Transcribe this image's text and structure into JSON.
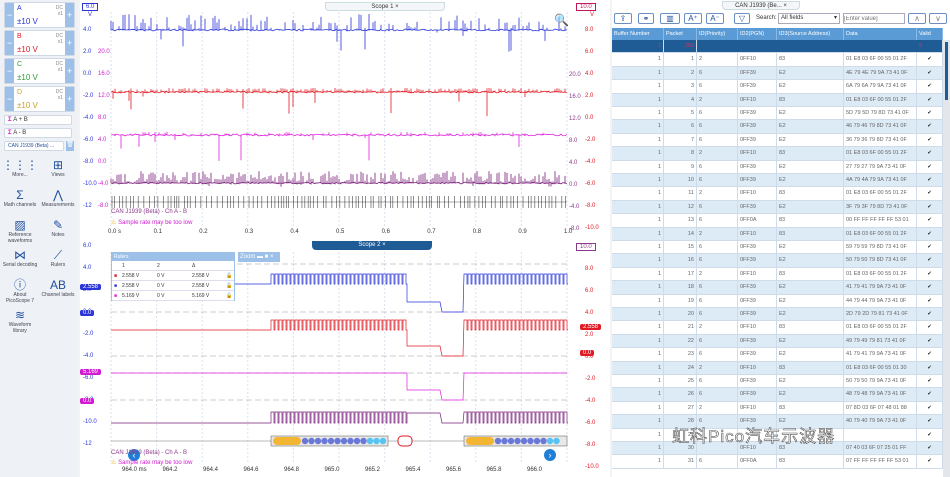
{
  "sidebar": {
    "channels": [
      {
        "name": "A",
        "range": "±10 V",
        "coupling": "DC",
        "probe": "x1",
        "color": "#2b35d8"
      },
      {
        "name": "B",
        "range": "±10 V",
        "coupling": "DC",
        "probe": "x1",
        "color": "#e01b24"
      },
      {
        "name": "C",
        "range": "±10 V",
        "coupling": "DC",
        "probe": "x1",
        "color": "#2e9e3a"
      },
      {
        "name": "D",
        "range": "±10 V",
        "coupling": "DC",
        "probe": "x1",
        "color": "#c9a227"
      }
    ],
    "math": [
      {
        "label": "A + B"
      },
      {
        "label": "A - B"
      }
    ],
    "decoder": "CAN J1939 (Beta) ...",
    "tools": [
      {
        "label": "More...",
        "icon": "⋮⋮⋮"
      },
      {
        "label": "Views",
        "icon": "⊞"
      },
      {
        "label": "Math channels",
        "icon": "Σ"
      },
      {
        "label": "Measurements",
        "icon": "⋀"
      },
      {
        "label": "Reference waveforms",
        "icon": "▨"
      },
      {
        "label": "Notes",
        "icon": "✎"
      },
      {
        "label": "Serial decoding",
        "icon": "⋈"
      },
      {
        "label": "Rulers",
        "icon": "⟋"
      },
      {
        "label": "About PicoScope 7",
        "icon": "ⓘ"
      },
      {
        "label": "Channel labels",
        "icon": "AB"
      },
      {
        "label": "Waveform library",
        "icon": "≋"
      }
    ]
  },
  "scope1": {
    "tab": "Scope 1",
    "left_top": "6.0",
    "right_top": "10.0",
    "unit": "V",
    "axis_a": [
      "4.0",
      "2.0",
      "0.0",
      "-2.0",
      "-4.0",
      "-6.0",
      "-8.0",
      "-10.0",
      "-12"
    ],
    "axis_b": [
      "20.0",
      "16.0",
      "12.0",
      "8.0",
      "4.0",
      "0.0",
      "-4.0",
      "-8.0"
    ],
    "axis_r1": [
      "20.0",
      "16.0",
      "12.0",
      "8.0",
      "4.0",
      "0.0",
      "-4.0",
      "-8.0"
    ],
    "axis_r2": [
      "8.0",
      "6.0",
      "4.0",
      "2.0",
      "0.0",
      "-2.0",
      "-4.0",
      "-6.0",
      "-8.0",
      "-10.0"
    ],
    "time": [
      "0.0 s",
      "0.1",
      "0.2",
      "0.3",
      "0.4",
      "0.5",
      "0.6",
      "0.7",
      "0.8",
      "0.9",
      "1.0"
    ],
    "decoder_label": "CAN J1939 (Beta) - Ch A - B",
    "warning": "Sample rate may be too low"
  },
  "scope2": {
    "tab": "Scope 2",
    "right_top": "10.0",
    "axis_a": [
      "6.0",
      "4.0",
      "2.0",
      "0.0",
      "-2.0",
      "-4.0",
      "-6.0",
      "-8.0",
      "-10.0",
      "-12"
    ],
    "axis_r2": [
      "8.0",
      "6.0",
      "4.0",
      "2.0",
      "0.0",
      "-2.0",
      "-4.0",
      "-6.0",
      "-8.0",
      "-10.0"
    ],
    "markers": {
      "a_ruler": "2.558",
      "a_zero": "0.0",
      "b_ruler": "2.558",
      "b_zero": "0.0",
      "c_ruler": "5.169",
      "c_zero": "0.0"
    },
    "time": [
      "964.0 ms",
      "964.2",
      "964.4",
      "964.6",
      "964.8",
      "965.0",
      "965.2",
      "965.4",
      "965.6",
      "965.8",
      "966.0"
    ],
    "decoder_label": "CAN J1939 (Beta) - Ch A - B",
    "warning": "Sample rate may be too low",
    "rulers": {
      "title": "Rulers",
      "cols": [
        "1",
        "2",
        "Δ"
      ],
      "rows": [
        {
          "color": "#e01b24",
          "v1": "2.558 V",
          "v2": "0 V",
          "d": "2.558 V"
        },
        {
          "color": "#2b35d8",
          "v1": "2.558 V",
          "v2": "0 V",
          "d": "2.558 V"
        },
        {
          "color": "#e020e0",
          "v1": "5.169 V",
          "v2": "0 V",
          "d": "5.169 V"
        }
      ]
    },
    "zoom_title": "Zoom"
  },
  "table": {
    "tab": "CAN J1939 (Be... ×",
    "search_label": "Search:",
    "search_field": "All fields",
    "search_placeholder": "[Enter value]",
    "columns": [
      "Buffer Number",
      "Packet",
      "ID(Priority)",
      "ID2(PGN)",
      "ID3(Source Address)",
      "Data",
      "Valid"
    ],
    "summary": {
      "buffer": "1",
      "packet": "250",
      "valid": "8"
    },
    "rows": [
      [
        "1",
        "1",
        "2",
        "0FF10",
        "83",
        "01 E8 03 6F 00 55 01 2F"
      ],
      [
        "1",
        "2",
        "6",
        "0FF39",
        "E2",
        "4E 79 4E 79 9A 73 41 0F"
      ],
      [
        "1",
        "3",
        "6",
        "0FF39",
        "E2",
        "6A 79 6A 79 9A 73 41 0F"
      ],
      [
        "1",
        "4",
        "2",
        "0FF10",
        "83",
        "01 E8 03 6F 00 55 01 2F"
      ],
      [
        "1",
        "5",
        "6",
        "0FF39",
        "E2",
        "5D 79 5D 79 8D 73 41 0F"
      ],
      [
        "1",
        "6",
        "6",
        "0FF39",
        "E2",
        "46 79 46 79 8D 73 41 0F"
      ],
      [
        "1",
        "7",
        "6",
        "0FF39",
        "E2",
        "36 79 36 79 8D 73 41 0F"
      ],
      [
        "1",
        "8",
        "2",
        "0FF10",
        "83",
        "01 E8 03 6F 00 55 01 2F"
      ],
      [
        "1",
        "9",
        "6",
        "0FF39",
        "E2",
        "27 79 27 79 9A 73 41 0F"
      ],
      [
        "1",
        "10",
        "6",
        "0FF39",
        "E2",
        "4A 79 4A 79 9A 73 41 0F"
      ],
      [
        "1",
        "11",
        "2",
        "0FF10",
        "83",
        "01 E8 03 6F 00 55 01 2F"
      ],
      [
        "1",
        "12",
        "6",
        "0FF39",
        "E2",
        "3F 79 3F 79 8D 73 41 0F"
      ],
      [
        "1",
        "13",
        "6",
        "0FF0A",
        "83",
        "00 FF FF FF FF FF 53 01"
      ],
      [
        "1",
        "14",
        "2",
        "0FF10",
        "83",
        "01 E8 03 6F 00 55 01 2F"
      ],
      [
        "1",
        "15",
        "6",
        "0FF39",
        "E2",
        "59 79 59 79 8D 73 41 0F"
      ],
      [
        "1",
        "16",
        "6",
        "0FF39",
        "E2",
        "50 79 50 79 8D 73 41 0F"
      ],
      [
        "1",
        "17",
        "2",
        "0FF10",
        "83",
        "01 E8 03 6F 00 55 01 2F"
      ],
      [
        "1",
        "18",
        "6",
        "0FF39",
        "E2",
        "41 79 41 79 9A 73 41 0F"
      ],
      [
        "1",
        "19",
        "6",
        "0FF39",
        "E2",
        "44 79 44 79 9A 73 41 0F"
      ],
      [
        "1",
        "20",
        "6",
        "0FF39",
        "E2",
        "2D 79 2D 79 81 73 41 0F"
      ],
      [
        "1",
        "21",
        "2",
        "0FF10",
        "83",
        "01 E8 03 6F 00 55 01 2F"
      ],
      [
        "1",
        "22",
        "6",
        "0FF39",
        "E2",
        "49 79 49 79 81 73 41 0F"
      ],
      [
        "1",
        "23",
        "6",
        "0FF39",
        "E2",
        "41 79 41 79 9A 73 41 0F"
      ],
      [
        "1",
        "24",
        "2",
        "0FF10",
        "83",
        "01 E8 03 6F 00 55 01 30"
      ],
      [
        "1",
        "25",
        "6",
        "0FF39",
        "E2",
        "50 79 50 79 9A 73 41 0F"
      ],
      [
        "1",
        "26",
        "6",
        "0FF39",
        "E2",
        "48 79 48 79 9A 73 41 0F"
      ],
      [
        "1",
        "27",
        "2",
        "0FF10",
        "83",
        "07 8D 03 6F 07 48 01 88"
      ],
      [
        "1",
        "28",
        "6",
        "0FF39",
        "E2",
        "40 79 40 79 9A 73 41 0F"
      ],
      [
        "1",
        "29",
        "",
        "",
        "",
        ""
      ],
      [
        "1",
        "30",
        "",
        "0FF10",
        "83",
        "07 40 03 6F 07 25 01 FF"
      ],
      [
        "1",
        "31",
        "6",
        "0FF0A",
        "83",
        "07 FF FF FF FF FF 53 01"
      ]
    ]
  },
  "watermark": "虹科Pico汽车示波器"
}
